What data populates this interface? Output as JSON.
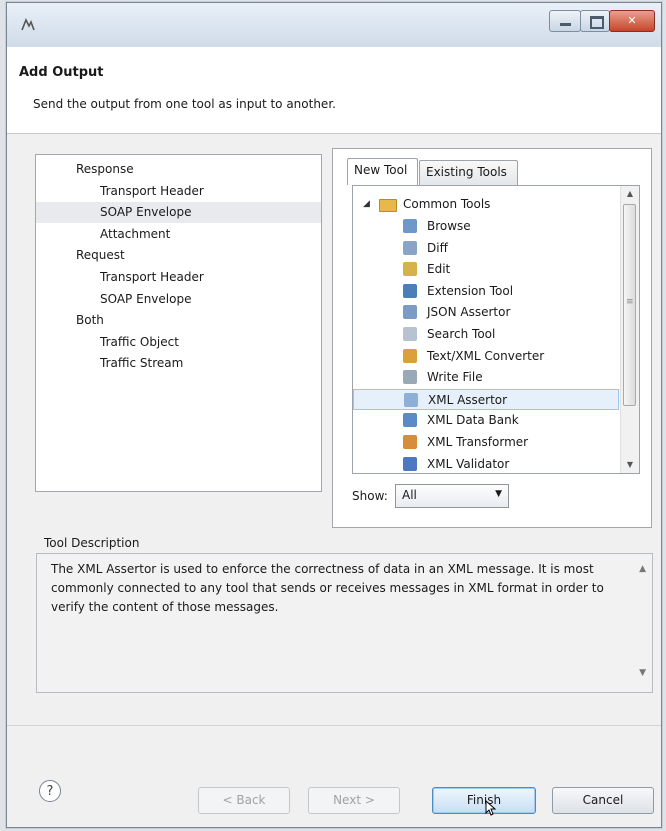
{
  "dialog": {
    "title": "Add Output",
    "subtitle": "Send the output from one tool as input to another."
  },
  "left_tree": [
    {
      "label": "Response",
      "level": 0,
      "selected": false
    },
    {
      "label": "Transport Header",
      "level": 1,
      "selected": false
    },
    {
      "label": "SOAP Envelope",
      "level": 1,
      "selected": true
    },
    {
      "label": "Attachment",
      "level": 1,
      "selected": false
    },
    {
      "label": "Request",
      "level": 0,
      "selected": false
    },
    {
      "label": "Transport Header",
      "level": 1,
      "selected": false
    },
    {
      "label": "SOAP Envelope",
      "level": 1,
      "selected": false
    },
    {
      "label": "Both",
      "level": 0,
      "selected": false
    },
    {
      "label": "Traffic Object",
      "level": 1,
      "selected": false
    },
    {
      "label": "Traffic Stream",
      "level": 1,
      "selected": false
    }
  ],
  "tabs": [
    {
      "label": "New Tool",
      "active": true
    },
    {
      "label": "Existing Tools",
      "active": false
    }
  ],
  "tool_category": "Common Tools",
  "tools": [
    {
      "label": "Browse",
      "icon": "browse-icon",
      "color": "#6f97c9",
      "selected": false
    },
    {
      "label": "Diff",
      "icon": "diff-icon",
      "color": "#8aa4c8",
      "selected": false
    },
    {
      "label": "Edit",
      "icon": "edit-icon",
      "color": "#d6b24a",
      "selected": false
    },
    {
      "label": "Extension Tool",
      "icon": "extension-tool-icon",
      "color": "#4a7fb8",
      "selected": false
    },
    {
      "label": "JSON Assertor",
      "icon": "json-assertor-icon",
      "color": "#7c9cc6",
      "selected": false
    },
    {
      "label": "Search Tool",
      "icon": "search-tool-icon",
      "color": "#b7c3d1",
      "selected": false
    },
    {
      "label": "Text/XML Converter",
      "icon": "text-xml-converter-icon",
      "color": "#d9a03c",
      "selected": false
    },
    {
      "label": "Write File",
      "icon": "write-file-icon",
      "color": "#9aa9b8",
      "selected": false
    },
    {
      "label": "XML Assertor",
      "icon": "xml-assertor-icon",
      "color": "#8fb0d6",
      "selected": true
    },
    {
      "label": "XML Data Bank",
      "icon": "xml-data-bank-icon",
      "color": "#5b8bc7",
      "selected": false
    },
    {
      "label": "XML Transformer",
      "icon": "xml-transformer-icon",
      "color": "#d98c3a",
      "selected": false
    },
    {
      "label": "XML Validator",
      "icon": "xml-validator-icon",
      "color": "#4b78c0",
      "selected": false
    }
  ],
  "show": {
    "label": "Show:",
    "value": "All"
  },
  "description": {
    "label": "Tool Description",
    "text": "The XML Assertor is used to enforce the correctness of data in an XML message. It is most commonly connected to any tool that sends or receives messages in XML format in order to verify the content of those messages."
  },
  "buttons": {
    "back": "< Back",
    "next": "Next >",
    "finish": "Finish",
    "cancel": "Cancel",
    "help": "?"
  }
}
